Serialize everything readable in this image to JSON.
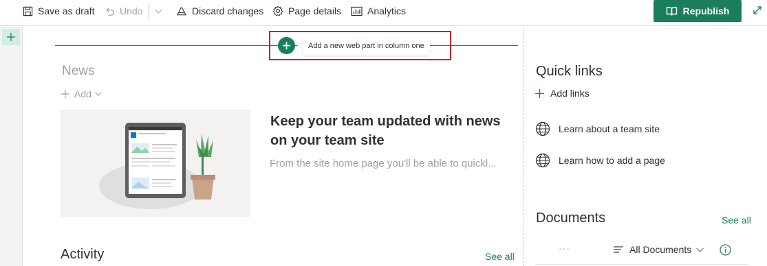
{
  "toolbar": {
    "save_draft": "Save as draft",
    "undo": "Undo",
    "discard": "Discard changes",
    "page_details": "Page details",
    "analytics": "Analytics",
    "republish": "Republish"
  },
  "canvas": {
    "add_webpart_tooltip": "Add a new web part in column one"
  },
  "news": {
    "title": "News",
    "add_label": "Add",
    "headline": "Keep your team updated with news on your team site",
    "description": "From the site home page you'll be able to quickl..."
  },
  "activity": {
    "title": "Activity",
    "see_all": "See all"
  },
  "quick_links": {
    "title": "Quick links",
    "add_links": "Add links",
    "items": [
      {
        "label": "Learn about a team site",
        "icon": "globe-icon"
      },
      {
        "label": "Learn how to add a page",
        "icon": "globe-icon"
      }
    ]
  },
  "documents": {
    "title": "Documents",
    "see_all": "See all",
    "ellipsis": "···",
    "view": "All Documents"
  },
  "colors": {
    "accent": "#1b7e5a",
    "highlight": "#c8202a",
    "muted_text": "#a19f9d"
  }
}
